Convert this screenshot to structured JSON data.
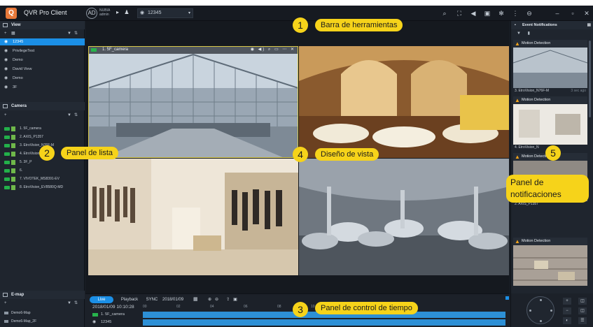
{
  "app": {
    "title": "QVR Pro Client",
    "user_initials": "AD",
    "user_label_1": "NUBIA",
    "user_label_2": "admin",
    "view_selector_value": "12345",
    "toolbar_icons": [
      "search-icon",
      "fullscreen-icon",
      "volume-icon",
      "lock-icon",
      "settings-icon",
      "more-icon",
      "logout-icon",
      "minimize-icon",
      "maximize-icon",
      "close-icon"
    ]
  },
  "left_panel": {
    "view_section": {
      "title": "View",
      "items": [
        "12345",
        "PrivilegeTest",
        "Demo",
        "David View",
        "Demo",
        "3F"
      ],
      "selected_index": 0
    },
    "camera_section": {
      "title": "Camera",
      "items": [
        "1. 5F_camera",
        "2. AXIS_P1357",
        "3. EtroVision_N76F-M",
        "4. EtroVision",
        "5. 3F_P",
        "6. ",
        "7. VIVOTEK_MS8391-EV",
        "8. EtroVision_EV8580Q-MD"
      ]
    },
    "emap_section": {
      "title": "E-map",
      "items": [
        "Demo6-Map",
        "Demo6-Map_2F"
      ]
    }
  },
  "view_tiles": [
    {
      "camera_label": "1. 5F_camera",
      "toolbar_glyphs": "◉ ◀) ⌕ ▭ ⋯ ✕"
    }
  ],
  "right_panel": {
    "title": "Event Notifications",
    "notifications": [
      {
        "type": "Motion Detection",
        "camera": "3. EtroVision_N76F-M",
        "time": "3 sec ago"
      },
      {
        "type": "Motion Detection",
        "camera": "4. EtroVision_N",
        "time": ""
      },
      {
        "type": "Motion Detection",
        "camera": "2. AXIS_P1357",
        "time": ""
      },
      {
        "type": "Motion Detection",
        "camera": "",
        "time": ""
      }
    ]
  },
  "time_control": {
    "live_label": "Live",
    "playback_label": "Playback",
    "sync_label": "SYNC",
    "date": "2018/01/09",
    "current_time": "2018/01/09 10:10:28",
    "ruler_ticks": [
      "00",
      "02",
      "04",
      "06",
      "08",
      "10",
      "12",
      "14",
      "16"
    ],
    "tracks": [
      {
        "label": "1. 5F_camera"
      },
      {
        "label": "12345"
      }
    ]
  },
  "callouts": {
    "c1": {
      "num": "1",
      "text": "Barra de herramientas"
    },
    "c2": {
      "num": "2",
      "text": "Panel de lista"
    },
    "c3": {
      "num": "3",
      "text": "Panel de control de tiempo"
    },
    "c4": {
      "num": "4",
      "text": "Diseño de vista"
    },
    "c5": {
      "num": "5",
      "text": "Panel de notificaciones"
    }
  },
  "colors": {
    "accent": "#1b8fe6",
    "callout": "#f6d31a",
    "live_green": "#27b34c",
    "warning": "#f0a21b"
  }
}
